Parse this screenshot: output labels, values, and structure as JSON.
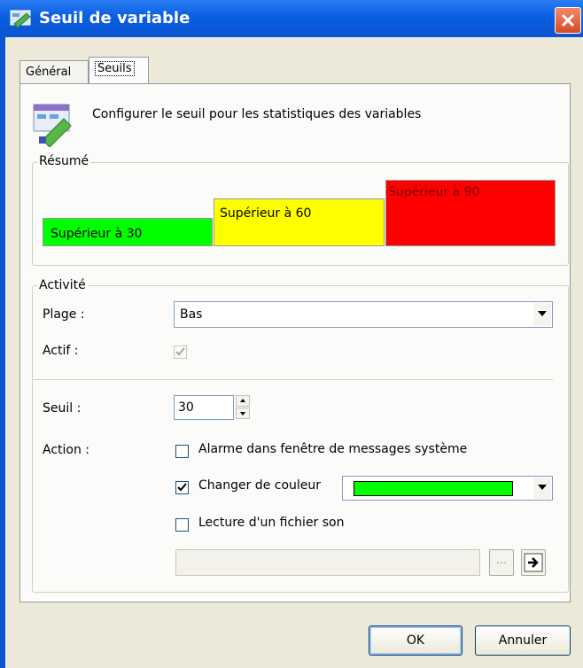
{
  "window": {
    "title": "Seuil de variable",
    "close_icon": "close-icon"
  },
  "tabs": [
    {
      "label": "Général",
      "active": false
    },
    {
      "label": "Seuils",
      "active": true
    }
  ],
  "header": {
    "description": "Configurer le seuil pour les statistiques des variables"
  },
  "summary": {
    "legend": "Résumé",
    "bars": [
      {
        "label": "Supérieur à 30",
        "color": "#00ff00"
      },
      {
        "label": "Supérieur à 60",
        "color": "#ffff00"
      },
      {
        "label": "Supérieur à 90",
        "color": "#ff0000"
      }
    ]
  },
  "activity": {
    "legend": "Activité",
    "range_label": "Plage :",
    "range_value": "Bas",
    "active_label": "Actif :",
    "active_checked": true,
    "threshold_label": "Seuil :",
    "threshold_value": "30",
    "action_label": "Action :",
    "actions": {
      "alarm": {
        "label": "Alarme dans fenêtre de messages système",
        "checked": false
      },
      "color": {
        "label": "Changer de couleur",
        "checked": true,
        "value": "#00ff00"
      },
      "sound": {
        "label": "Lecture d'un fichier son",
        "checked": false
      }
    },
    "browse_label": "...",
    "play_icon": "arrow-right-icon"
  },
  "footer": {
    "ok_label": "OK",
    "cancel_label": "Annuler"
  }
}
